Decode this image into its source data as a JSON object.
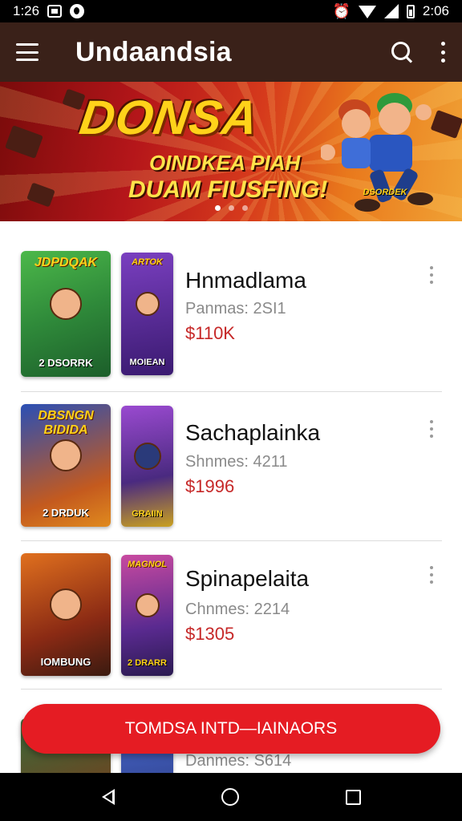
{
  "status_bar": {
    "time": "1:26",
    "right_time": "2:06",
    "icons": [
      "photo-icon",
      "pinterest-icon",
      "alarm-icon",
      "wifi-icon",
      "signal-icon",
      "battery-icon"
    ]
  },
  "app_bar": {
    "title": "Undaandsia",
    "icons": [
      "menu-icon",
      "search-icon",
      "more-icon"
    ]
  },
  "banner": {
    "brand": "DONSA",
    "line1": "OINDKEA PIAH",
    "line2": "DUAM FIUSFING!",
    "hero_tag": "DSORDEK",
    "pages": 3,
    "active_page": 0
  },
  "items": [
    {
      "name": "Hnmadlama",
      "meta": "Panmas: 2SI1",
      "price": "$110K",
      "thumb1": {
        "title": "JDPDQAK",
        "tag": "2 DSORRK"
      },
      "thumb2": {
        "title": "ARTOK",
        "tag": "MOIEAN"
      }
    },
    {
      "name": "Sachaplainka",
      "meta": "Shnmes: 4211",
      "price": "$1996",
      "thumb1": {
        "title": "DBSNGN BIDIDA",
        "tag": "2 DRDUK"
      },
      "thumb2": {
        "title": "",
        "tag": "GRAIIN"
      }
    },
    {
      "name": "Spinapelaita",
      "meta": "Chnmes: 2214",
      "price": "$1305",
      "thumb1": {
        "title": "",
        "tag": "IOMBUNG"
      },
      "thumb2": {
        "title": "MAGNOL",
        "tag": "2 DRARR"
      }
    },
    {
      "name": "",
      "meta": "Danmes: S614",
      "price": ""
    }
  ],
  "cta": {
    "label": "TOMDSA INTD—IAINAORS"
  },
  "colors": {
    "app_bar": "#3a2119",
    "accent": "#e51c23",
    "price": "#c62828"
  }
}
